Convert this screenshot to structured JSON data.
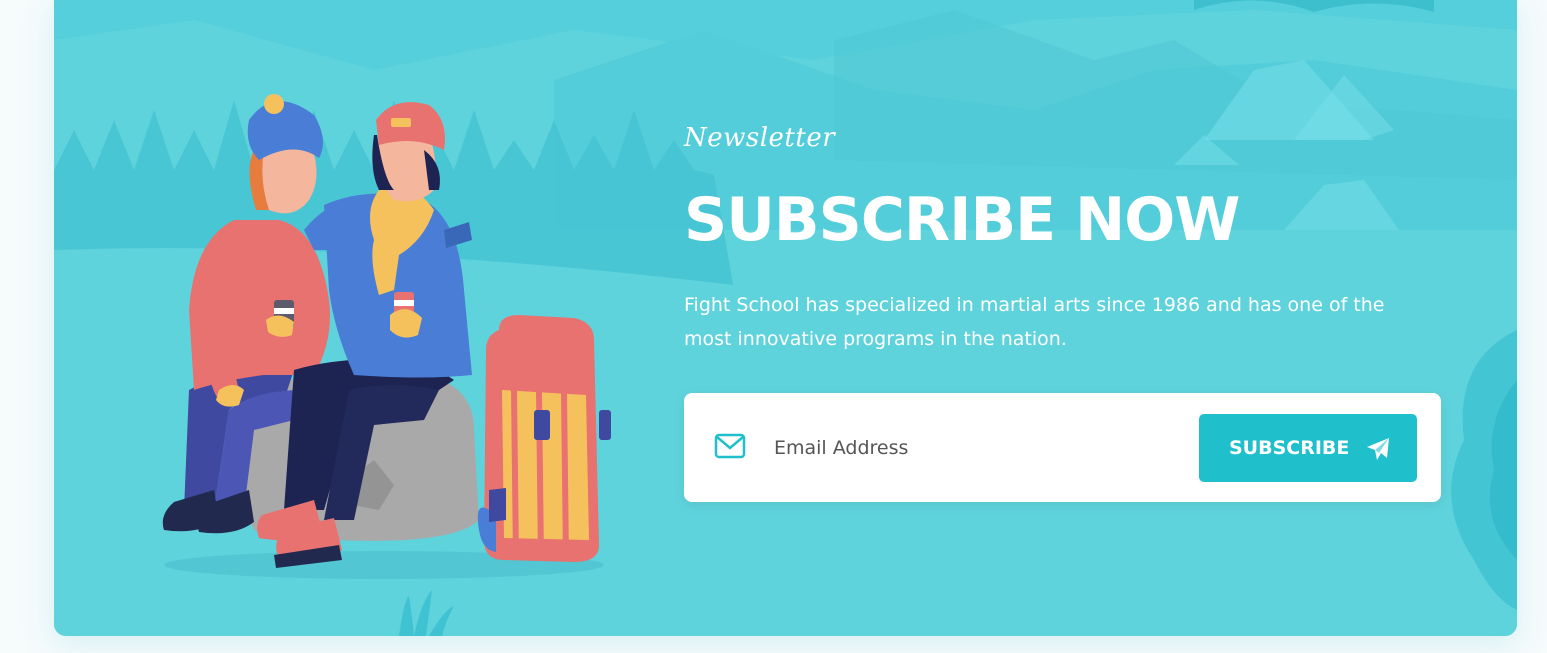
{
  "newsletter": {
    "eyebrow": "Newsletter",
    "title": "SUBSCRIBE NOW",
    "description": "Fight School has specialized in martial arts since 1986 and has one of the most innovative programs in the nation.",
    "email_placeholder": "Email Address",
    "email_value": "",
    "button_label": "SUBSCRIBE"
  },
  "colors": {
    "background": "#5fd3dc",
    "button": "#1fc0cc",
    "text": "#ffffff",
    "icon_accent": "#1fc0cc"
  },
  "icons": {
    "email": "mail-icon",
    "button": "send-icon"
  }
}
